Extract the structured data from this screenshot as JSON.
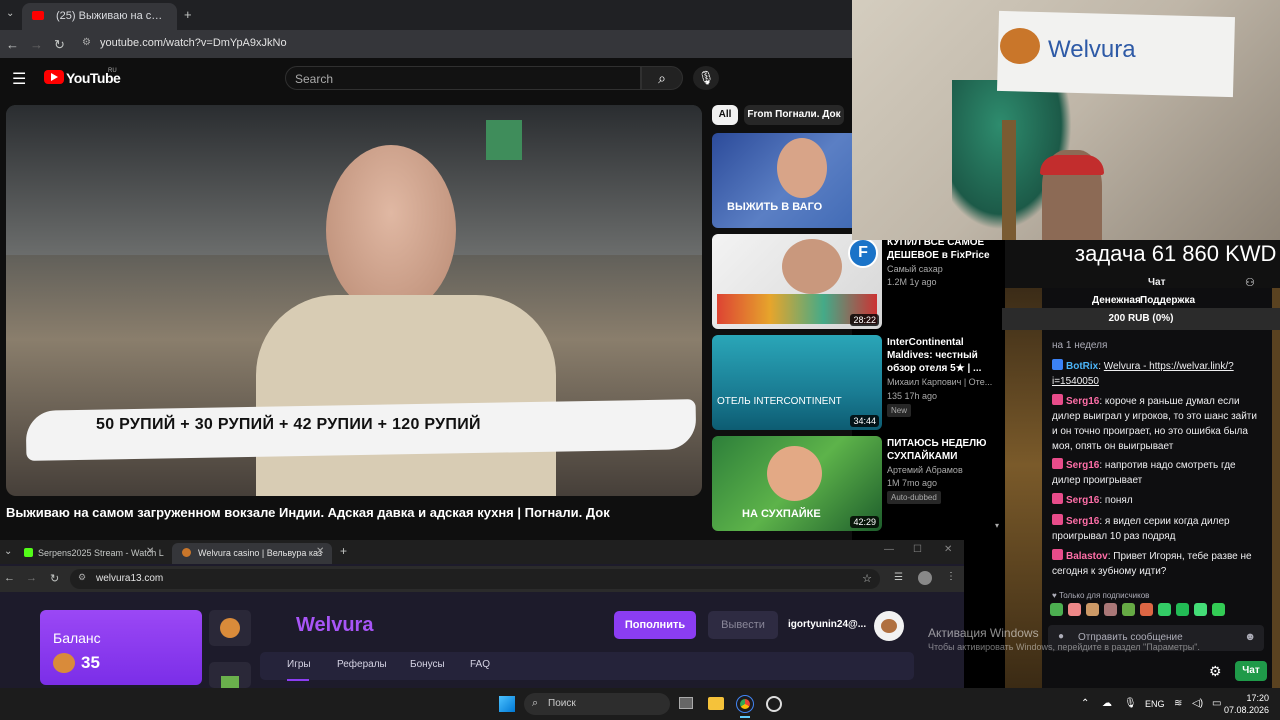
{
  "yt": {
    "tab_title": "(25) Выживаю на самом за",
    "url": "youtube.com/watch?v=DmYpA9xJkNo",
    "logo": "YouTube",
    "logo_sup": "RU",
    "search_placeholder": "Search",
    "chip_all": "All",
    "chip_from": "From Погнали. Док",
    "video_caption": "50 РУПИЙ + 30 РУПИЙ + 42 РУПИИ + 120 РУПИЙ",
    "video_title": "Выживаю на самом загруженном вокзале Индии. Адская давка и адская кухня | Погнали. Док",
    "related": [
      {
        "title": "",
        "thumb_text": "ВЫЖИТЬ В ВАГО",
        "channel": "",
        "meta": "",
        "duration": ""
      },
      {
        "title": "КУПИЛ ВСЕ САМОЕ ДЕШЕВОЕ в FixPrice",
        "thumb_text": "",
        "channel": "Самый сахар",
        "meta": "1.2M  1y ago",
        "duration": "28:22"
      },
      {
        "title": "InterContinental Maldives: честный обзор отеля 5★ | ...",
        "thumb_text": "ОТЕЛЬ INTERCONTINENT",
        "channel": "Михаил Карпович | Оте...",
        "meta": "135  17h ago",
        "duration": "34:44",
        "badge": "New"
      },
      {
        "title": "ПИТАЮСЬ НЕДЕЛЮ СУХПАЙКАМИ",
        "thumb_text": "НА СУХПАЙКЕ",
        "channel": "Артемий Абрамов",
        "meta": "1M  7mo ago",
        "duration": "42:29",
        "badge": "Auto-dubbed"
      }
    ]
  },
  "cam": {
    "sign": "Welvura"
  },
  "overlay": {
    "task": "задача 61 860 KWD",
    "money_label": "Денежная",
    "support_label": "Поддержка",
    "rub": "200 RUB (0%)"
  },
  "chat": {
    "title": "Чат",
    "top_note": "на 1 неделя",
    "messages": [
      {
        "nick": "BotRix",
        "color": "#4bb4f8",
        "text": "Welvura - https://welvar.link/?i=1540050"
      },
      {
        "nick": "Serg16",
        "color": "#ff6fa8",
        "text": "короче я раньше думал если дилер выиграл у игроков, то это шанс зайти и он точно проиграет, но это ошибка была моя, опять он выигрывает"
      },
      {
        "nick": "Serg16",
        "color": "#ff6fa8",
        "text": "напротив надо смотреть где дилер проигрывает"
      },
      {
        "nick": "Serg16",
        "color": "#ff6fa8",
        "text": "понял"
      },
      {
        "nick": "Serg16",
        "color": "#ff6fa8",
        "text": "я видел серии когда дилер проигрывал 10 раз подряд"
      },
      {
        "nick": "Balastov",
        "color": "#ff6fa8",
        "text": "Привет Игорян, тебе разве не сегодня к зубному идти?"
      }
    ],
    "subs_only": "Только для подписчиков",
    "input_placeholder": "Отправить сообщение",
    "send": "Чат"
  },
  "casino": {
    "tab1": "Serpens2025 Stream - Watch L",
    "tab2": "Welvura casino | Вельвура каз",
    "url": "welvura13.com",
    "balance_label": "Баланс",
    "balance_value": "35",
    "brand": "Welvura",
    "deposit": "Пополнить",
    "withdraw": "Вывести",
    "user": "igortyunin24@...",
    "nav": [
      "Игры",
      "Рефералы",
      "Бонусы",
      "FAQ"
    ]
  },
  "windows": {
    "activation_title": "Активация Windows",
    "activation_text": "Чтобы активировать Windows, перейдите в раздел \"Параметры\".",
    "search": "Поиск",
    "lang": "ENG",
    "time": "17:20",
    "date": "07.08.2026"
  }
}
